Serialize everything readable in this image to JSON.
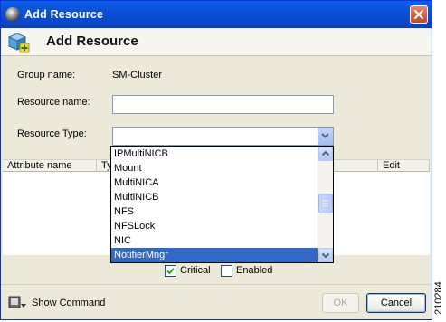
{
  "window": {
    "title": "Add Resource"
  },
  "header": {
    "title": "Add Resource"
  },
  "form": {
    "group_name_label": "Group name:",
    "group_name_value": "SM-Cluster",
    "resource_name_label": "Resource name:",
    "resource_name_value": "",
    "resource_type_label": "Resource Type:",
    "resource_type_value": ""
  },
  "table": {
    "columns": [
      "Attribute name",
      "Ty",
      "Edit"
    ]
  },
  "dropdown": {
    "items": [
      "IPMultiNICB",
      "Mount",
      "MultiNICA",
      "MultiNICB",
      "NFS",
      "NFSLock",
      "NIC",
      "NotifierMngr"
    ],
    "selected_index": 7
  },
  "options": {
    "critical_label": "Critical",
    "critical_checked": true,
    "enabled_label": "Enabled",
    "enabled_checked": false
  },
  "footer": {
    "show_command_label": "Show Command",
    "ok_label": "OK",
    "cancel_label": "Cancel"
  },
  "side_code": "210284",
  "colors": {
    "title_bar": "#0b4fd6",
    "selection": "#316ac5",
    "window_bg": "#ece9d8"
  }
}
